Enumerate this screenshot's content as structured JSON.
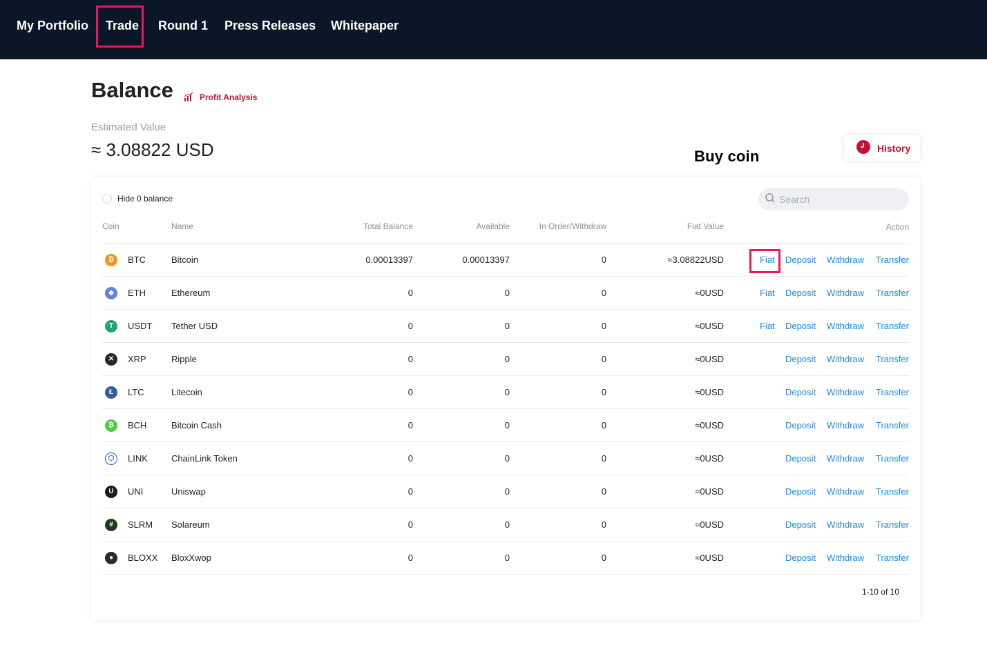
{
  "nav": {
    "items": [
      "My Portfolio",
      "Trade",
      "Round 1",
      "Press Releases",
      "Whitepaper"
    ]
  },
  "balance": {
    "title": "Balance",
    "profit_analysis": "Profit Analysis",
    "estimated_label": "Estimated Value",
    "estimated_value": "≈ 3.08822 USD",
    "history": "History"
  },
  "annotation": {
    "text": "Buy coin",
    "color": "#e8185a"
  },
  "table": {
    "hide_zero_label": "Hide 0 balance",
    "search_placeholder": "Search",
    "headers": {
      "coin": "Coin",
      "name": "Name",
      "total": "Total Balance",
      "available": "Available",
      "in_order": "In Order/Withdraw",
      "fiat_value": "Fiat Value",
      "action": "Action"
    },
    "rows": [
      {
        "symbol": "BTC",
        "name": "Bitcoin",
        "total": "0.00013397",
        "available": "0.00013397",
        "in_order": "0",
        "fiat": "≈3.08822USD",
        "icon": "btc-icon",
        "color": "#f7931a",
        "glyph": "₿",
        "fiat_action": "Fiat"
      },
      {
        "symbol": "ETH",
        "name": "Ethereum",
        "total": "0",
        "available": "0",
        "in_order": "0",
        "fiat": "≈0USD",
        "icon": "eth-icon",
        "color": "#627eea",
        "glyph": "◆",
        "fiat_action": "Fiat"
      },
      {
        "symbol": "USDT",
        "name": "Tether USD",
        "total": "0",
        "available": "0",
        "in_order": "0",
        "fiat": "≈0USD",
        "icon": "usdt-icon",
        "color": "#26a17b",
        "glyph": "T",
        "fiat_action": "Fiat"
      },
      {
        "symbol": "XRP",
        "name": "Ripple",
        "total": "0",
        "available": "0",
        "in_order": "0",
        "fiat": "≈0USD",
        "icon": "xrp-icon",
        "color": "#23292f",
        "glyph": "✕",
        "fiat_action": ""
      },
      {
        "symbol": "LTC",
        "name": "Litecoin",
        "total": "0",
        "available": "0",
        "in_order": "0",
        "fiat": "≈0USD",
        "icon": "ltc-icon",
        "color": "#345d9d",
        "glyph": "Ł",
        "fiat_action": ""
      },
      {
        "symbol": "BCH",
        "name": "Bitcoin Cash",
        "total": "0",
        "available": "0",
        "in_order": "0",
        "fiat": "≈0USD",
        "icon": "bch-icon",
        "color": "#4cc947",
        "glyph": "₿",
        "fiat_action": ""
      },
      {
        "symbol": "LINK",
        "name": "ChainLink Token",
        "total": "0",
        "available": "0",
        "in_order": "0",
        "fiat": "≈0USD",
        "icon": "link-icon",
        "color": "#ffffff",
        "glyph": "⬡",
        "fiat_action": ""
      },
      {
        "symbol": "UNI",
        "name": "Uniswap",
        "total": "0",
        "available": "0",
        "in_order": "0",
        "fiat": "≈0USD",
        "icon": "uni-icon",
        "color": "#1a1a1a",
        "glyph": "U",
        "fiat_action": ""
      },
      {
        "symbol": "SLRM",
        "name": "Solareum",
        "total": "0",
        "available": "0",
        "in_order": "0",
        "fiat": "≈0USD",
        "icon": "slrm-icon",
        "color": "#1f3a1f",
        "glyph": "#",
        "fiat_action": ""
      },
      {
        "symbol": "BLOXX",
        "name": "BloxXwop",
        "total": "0",
        "available": "0",
        "in_order": "0",
        "fiat": "≈0USD",
        "icon": "bloxx-icon",
        "color": "#2a2a2a",
        "glyph": "●",
        "fiat_action": ""
      }
    ],
    "actions": {
      "deposit": "Deposit",
      "withdraw": "Withdraw",
      "transfer": "Transfer"
    },
    "pagination": "1-10 of 10"
  }
}
